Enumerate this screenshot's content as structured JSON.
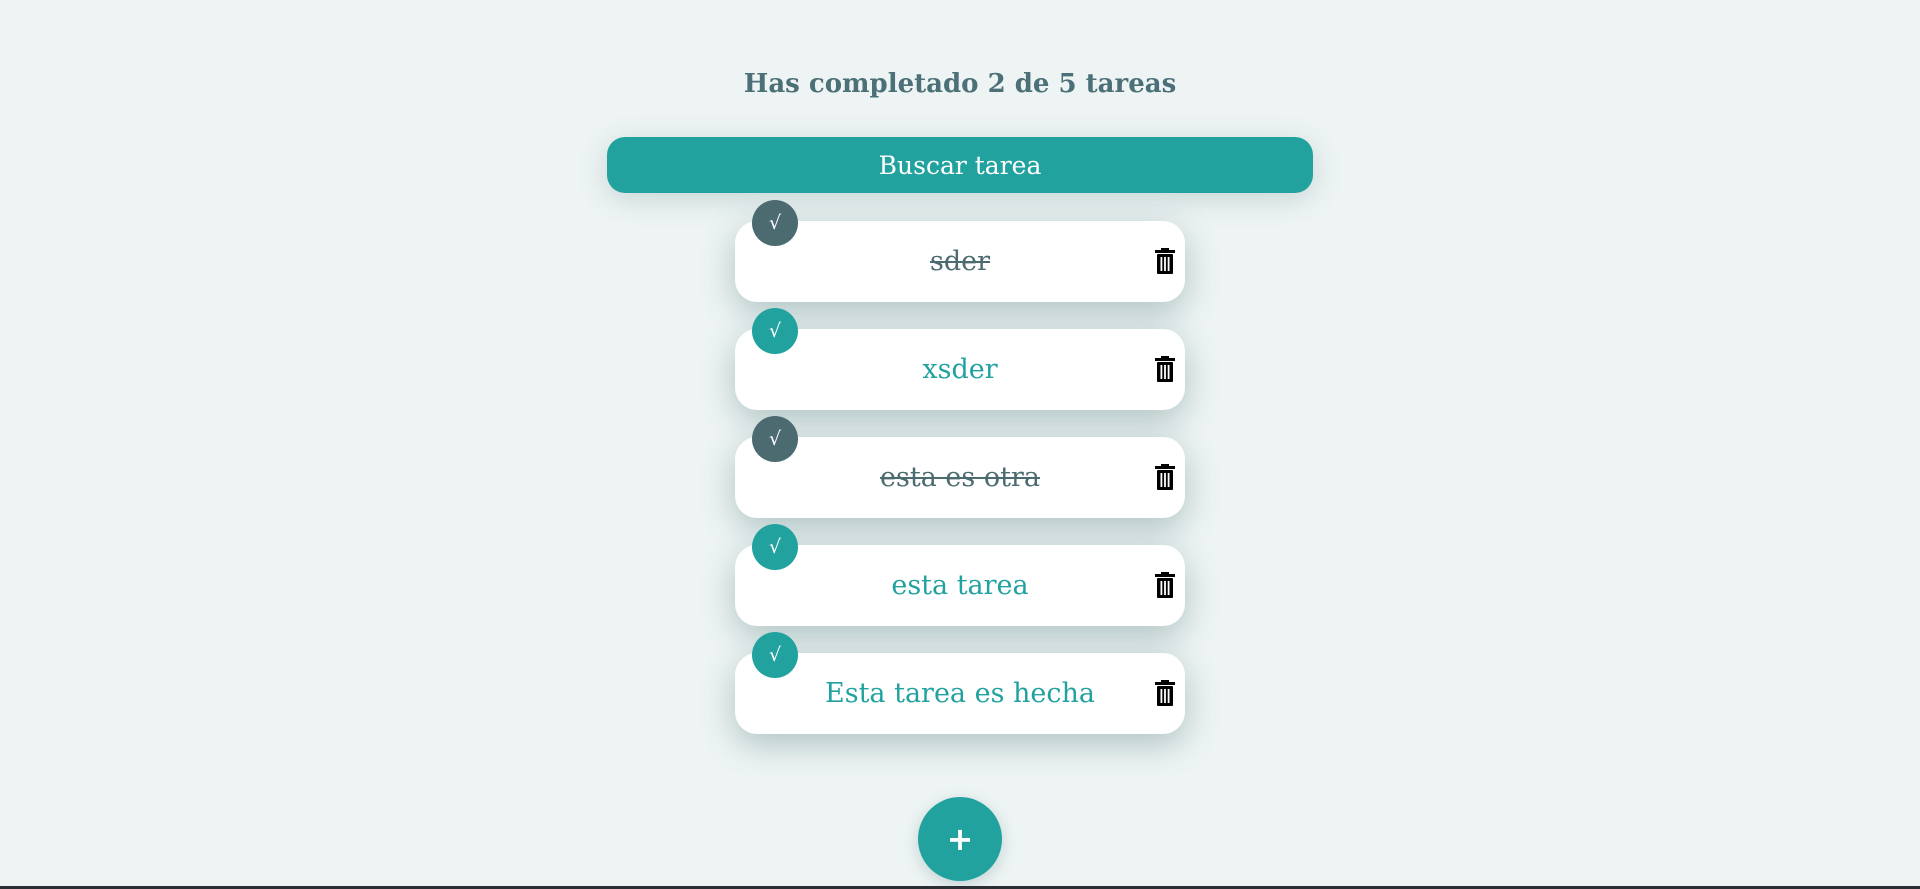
{
  "header": {
    "counter_text": "Has completado 2 de 5 tareas"
  },
  "search": {
    "placeholder": "Buscar tarea",
    "value": ""
  },
  "todos": [
    {
      "text": "sder",
      "completed": true,
      "check_glyph": "√"
    },
    {
      "text": "xsder",
      "completed": false,
      "check_glyph": "√"
    },
    {
      "text": "esta es otra",
      "completed": true,
      "check_glyph": "√"
    },
    {
      "text": "esta tarea",
      "completed": false,
      "check_glyph": "√"
    },
    {
      "text": "Esta tarea es hecha",
      "completed": false,
      "check_glyph": "√"
    }
  ],
  "add_button": {
    "label": "+"
  },
  "icons": {
    "check": "check-icon",
    "delete": "trash-icon"
  },
  "colors": {
    "background": "#eef4f4",
    "accent": "#22a29f",
    "completed": "#4b6b70",
    "counter_text": "#4b7077",
    "card": "#ffffff"
  }
}
